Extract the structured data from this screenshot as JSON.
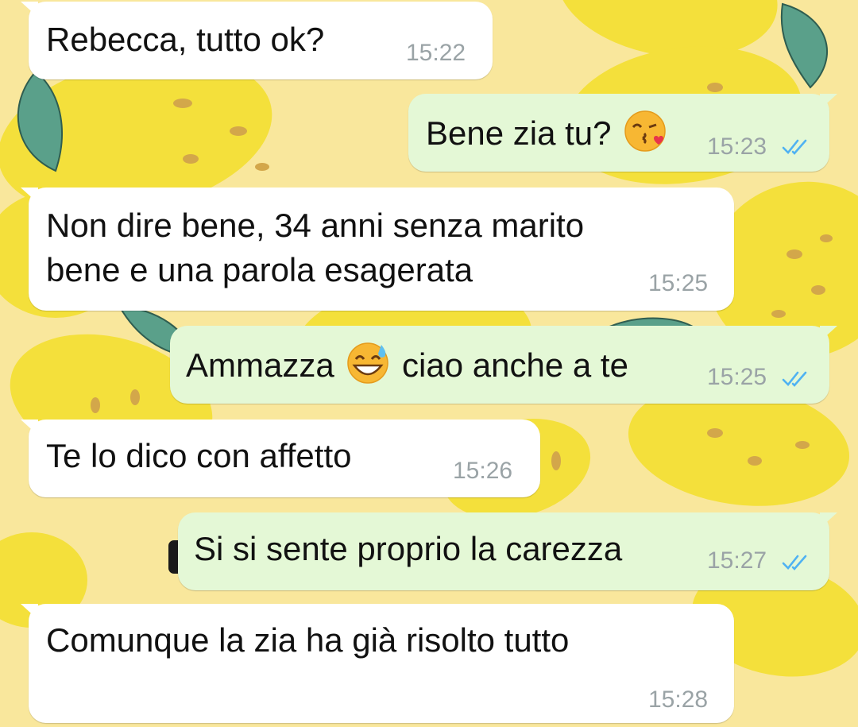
{
  "colors": {
    "wallpaper_bg": "#f9e79c",
    "lemon": "#f4e03b",
    "lemon_spot": "#d3a74a",
    "leaf": "#5aa08a",
    "incoming_bubble": "#ffffff",
    "outgoing_bubble": "#e4f8d6",
    "read_ticks": "#4fb2f2",
    "timestamp": "#9aa3a6"
  },
  "messages": [
    {
      "direction": "incoming",
      "text": "Rebecca, tutto ok?",
      "time": "15:22"
    },
    {
      "direction": "outgoing",
      "text": "Bene zia tu?",
      "emoji": "face-blowing-a-kiss",
      "time": "15:23",
      "status": "read-double-check"
    },
    {
      "direction": "incoming",
      "lines": [
        "Non dire bene, 34 anni senza marito",
        "bene e una parola esagerata"
      ],
      "time": "15:25"
    },
    {
      "direction": "outgoing",
      "text_before": "Ammazza",
      "emoji": "grinning-face-with-sweat",
      "text_after": "ciao anche a te",
      "time": "15:25",
      "status": "read-double-check"
    },
    {
      "direction": "incoming",
      "text": "Te lo dico con affetto",
      "time": "15:26"
    },
    {
      "direction": "outgoing",
      "text": "Si si sente proprio la carezza",
      "time": "15:27",
      "status": "read-double-check"
    },
    {
      "direction": "incoming",
      "text": "Comunque la zia ha già risolto tutto",
      "time": "15:28"
    }
  ]
}
